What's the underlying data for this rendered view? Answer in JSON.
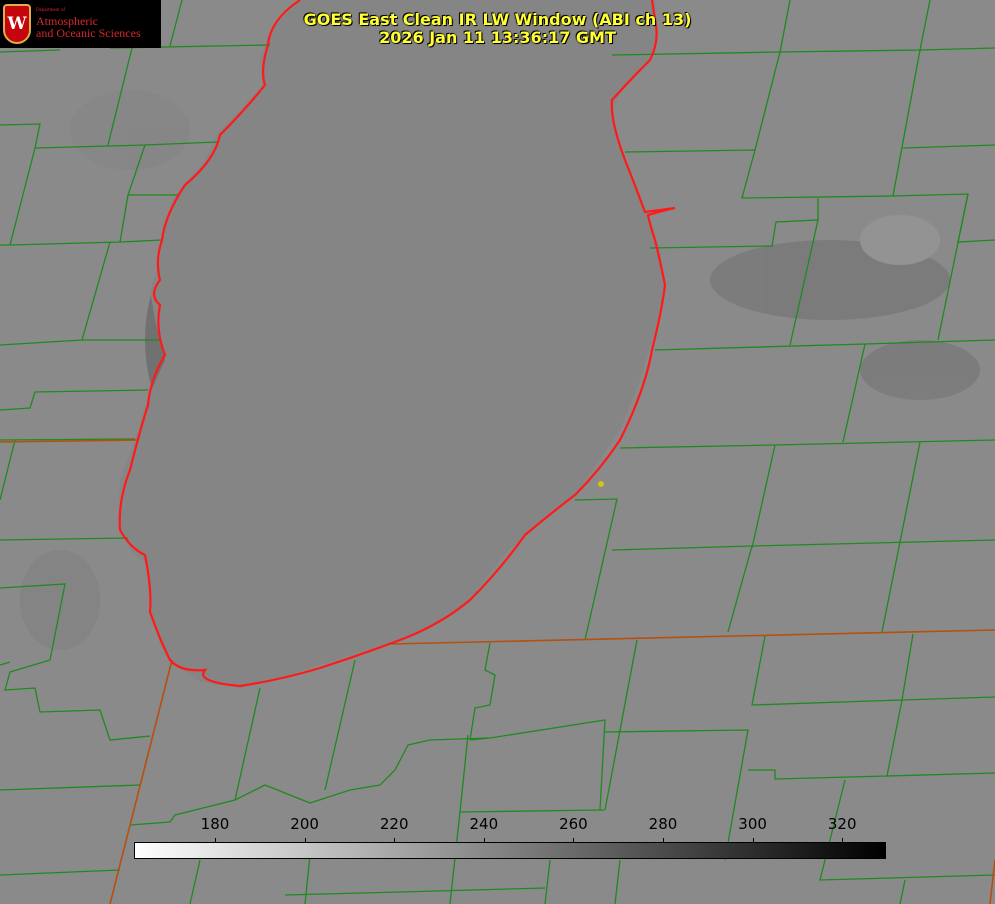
{
  "title": {
    "line1": "GOES East Clean IR LW Window (ABI ch 13)",
    "line2": "2026 Jan 11 13:36:17 GMT"
  },
  "logo": {
    "department": "Department of",
    "line1": "Atmospheric",
    "line2": "and Oceanic Sciences",
    "crest_letter": "W"
  },
  "colorbar": {
    "ticks": [
      "180",
      "200",
      "220",
      "240",
      "260",
      "280",
      "300",
      "320"
    ],
    "gradient": [
      "#ffffff",
      "#000000"
    ]
  },
  "colors": {
    "background": "#8a8a8a",
    "lake": "#848484",
    "county_lines": "#1f8a1f",
    "coastline": "#ff1a1a",
    "state_lines": "#b5500f",
    "station_marker": "#d4c21a",
    "title_text": "#ffff33"
  }
}
